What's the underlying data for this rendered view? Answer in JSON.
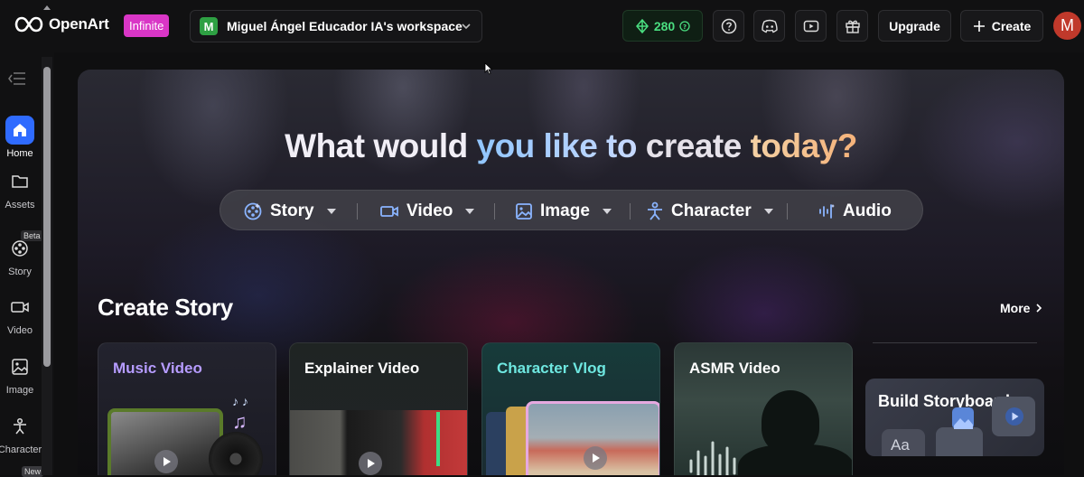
{
  "brand": {
    "name": "OpenArt",
    "plan_badge": "Infinite"
  },
  "workspace": {
    "initial": "M",
    "name": "Miguel Ángel Educador IA's workspace"
  },
  "credits": {
    "value": "280"
  },
  "header_buttons": {
    "help_icon": "question-circle-icon",
    "discord_icon": "discord-icon",
    "youtube_icon": "youtube-icon",
    "gift_icon": "gift-icon",
    "upgrade_label": "Upgrade",
    "create_label": "Create",
    "user_initial": "M"
  },
  "colors": {
    "accent": "#2f6bff",
    "infinite_badge": "#d936c6",
    "credits_green": "#4ade80",
    "avatar_red": "#c0392b",
    "workspace_green": "#2ea043"
  },
  "sidebar": {
    "items": [
      {
        "label": "Home",
        "icon": "home-icon",
        "active": true
      },
      {
        "label": "Assets",
        "icon": "folder-icon"
      },
      {
        "label": "Story",
        "icon": "film-reel-icon",
        "badge": "Beta"
      },
      {
        "label": "Video",
        "icon": "video-camera-icon"
      },
      {
        "label": "Image",
        "icon": "image-icon"
      },
      {
        "label": "Character",
        "icon": "person-icon",
        "badge": "New"
      }
    ]
  },
  "hero": {
    "title_part1": "What would",
    "title_part2": " you like to",
    "title_part3": " create",
    "title_part4": " today?",
    "modes": [
      {
        "label": "Story",
        "icon": "story-icon",
        "has_dropdown": true
      },
      {
        "label": "Video",
        "icon": "video-icon",
        "has_dropdown": true
      },
      {
        "label": "Image",
        "icon": "image-icon",
        "has_dropdown": true
      },
      {
        "label": "Character",
        "icon": "character-icon",
        "has_dropdown": true
      },
      {
        "label": "Audio",
        "icon": "audio-wave-icon",
        "has_dropdown": false
      }
    ]
  },
  "create_story": {
    "title": "Create Story",
    "more_label": "More",
    "cards": [
      {
        "title": "Music Video",
        "title_color": "#b69cff"
      },
      {
        "title": "Explainer Video",
        "title_color": "#ffffff"
      },
      {
        "title": "Character Vlog",
        "title_color": "#6ee7e0"
      },
      {
        "title": "ASMR Video",
        "title_color": "#ffffff"
      }
    ],
    "storyboard_label": "Build Storyboard →",
    "storyboard_thumb_text": "Aa"
  }
}
